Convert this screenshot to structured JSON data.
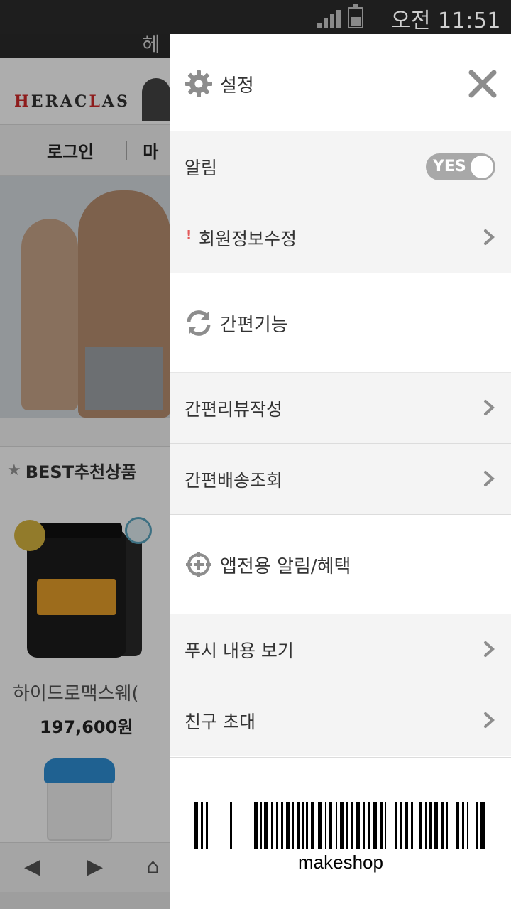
{
  "status_bar": {
    "time": "오전 11:51",
    "icons": [
      "signal-icon",
      "battery-icon"
    ]
  },
  "background_app": {
    "title_fragment": "헤",
    "logo_text": "HERACLAS",
    "nav": [
      "로그인",
      "마"
    ],
    "section_title": "BEST추천상품",
    "product_name": "하이드로맥스웨(",
    "product_price": "197,600원"
  },
  "panel": {
    "title": "설정",
    "notification": {
      "label": "알림",
      "toggle_text": "YES",
      "enabled": true
    },
    "member_info": {
      "label": "회원정보수정",
      "alert_mark": "!"
    },
    "easy_section": {
      "label": "간편기능"
    },
    "easy_items": [
      {
        "label": "간편리뷰작성"
      },
      {
        "label": "간편배송조회"
      }
    ],
    "app_section": {
      "label": "앱전용 알림/혜택"
    },
    "app_items": [
      {
        "label": "푸시 내용 보기"
      },
      {
        "label": "친구 초대"
      }
    ],
    "barcode_text": "makeshop"
  },
  "colors": {
    "panel_row_bg": "#f4f4f4",
    "icon_gray": "#8d8d8d",
    "toggle_bg": "#a8a8a8",
    "alert_red": "#e35a5a"
  }
}
